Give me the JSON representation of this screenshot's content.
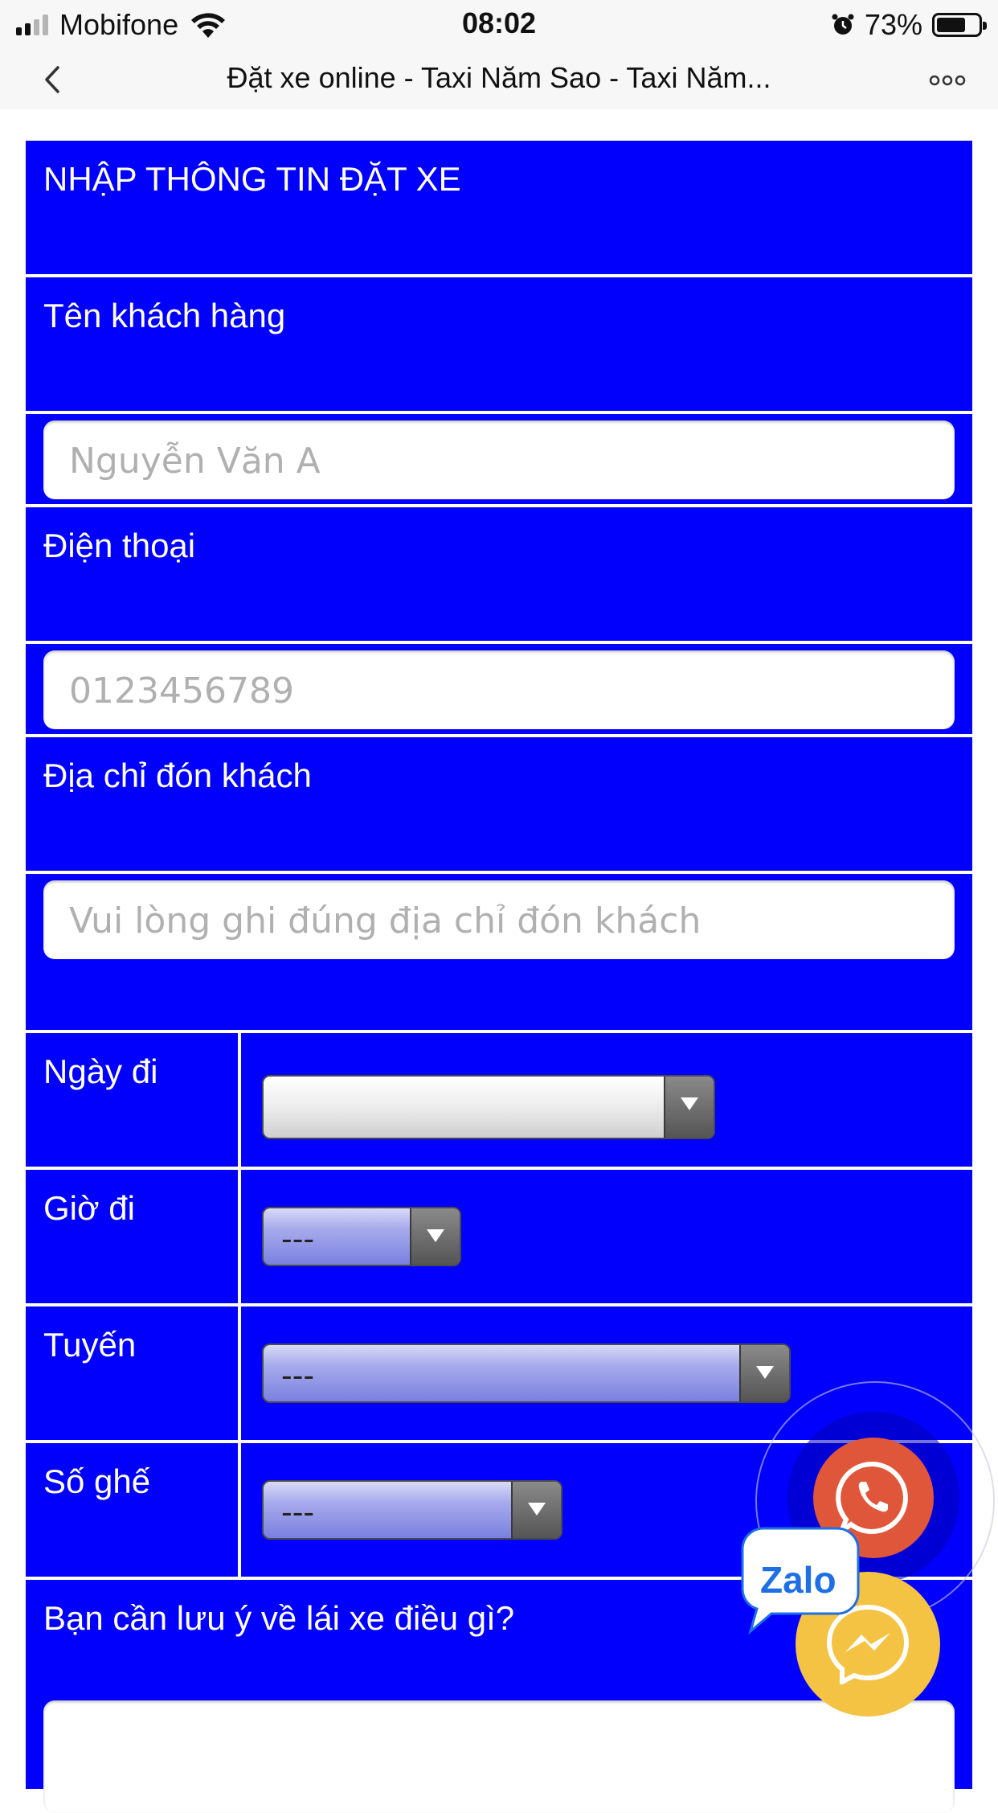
{
  "status_bar": {
    "carrier": "Mobifone",
    "time": "08:02",
    "battery_percent": "73%",
    "battery_level": 0.73,
    "icons": [
      "signal-icon",
      "wifi-icon",
      "alarm-icon",
      "battery-icon"
    ]
  },
  "nav": {
    "title": "Đặt xe online - Taxi Năm Sao - Taxi Năm...",
    "back_icon": "chevron-left-icon",
    "more_icon": "more-horizontal-icon"
  },
  "form": {
    "header": "NHẬP THÔNG TIN ĐẶT XE",
    "customer_name_label": "Tên khách hàng",
    "customer_name_placeholder": "Nguyễn Văn A",
    "phone_label": "Điện thoại",
    "phone_placeholder": "0123456789",
    "pickup_label": "Địa chỉ đón khách",
    "pickup_placeholder": "Vui lòng ghi đúng địa chỉ đón khách",
    "date_label": "Ngày đi",
    "date_value": "",
    "time_label": "Giờ đi",
    "time_value": "---",
    "route_label": "Tuyến",
    "route_value": "---",
    "seats_label": "Số ghế",
    "seats_value": "---",
    "note_label": "Bạn cần lưu ý về lái xe điều gì?"
  },
  "floating": {
    "zalo_label": "Zalo",
    "colors": {
      "phone": "#e0563a",
      "messenger": "#f5c343",
      "zalo": "#1e6fe6"
    }
  },
  "colors": {
    "form_bg": "#0000fc",
    "text": "#ffffff"
  }
}
